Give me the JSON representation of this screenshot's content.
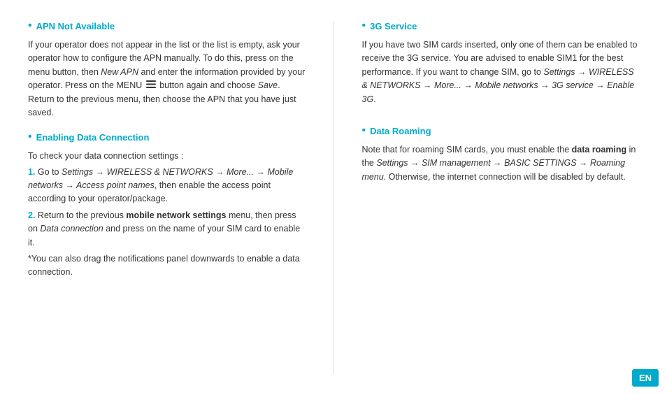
{
  "left": {
    "apn": {
      "title": "APN Not Available",
      "body": "If your operator does not appear in the list or the list is empty, ask your operator how to configure the APN manually. To do this, press on the menu button, then ",
      "new_apn": "New APN",
      "body2": " and enter the information provided by your operator. Press on the MENU ",
      "body3": " button again and choose ",
      "save": "Save",
      "body4": ". Return to the previous menu, then choose the APN that you have just saved."
    },
    "enabling": {
      "title": "Enabling Data Connection",
      "intro": "To check your data connection settings :",
      "step1_num": "1.",
      "step1_pre": "Go to ",
      "step1_italic": "Settings → WIRELESS & NETWORKS → More... → Mobile networks → Access point names",
      "step1_post": ", then enable the access point according to your operator/package.",
      "step2_num": "2.",
      "step2_pre": "Return to the previous ",
      "step2_bold": "mobile network settings",
      "step2_post": " menu, then press on ",
      "step2_italic": "Data connection",
      "step2_post2": " and press on the name of your SIM card to enable it.",
      "note": "*You can also drag the notifications panel downwards to enable a data connection."
    }
  },
  "right": {
    "service3g": {
      "title": "3G Service",
      "body": "If you have two SIM cards inserted, only one of them can be enabled to receive the 3G service. You are advised to enable SIM1 for the best performance. If you want to change SIM, go to ",
      "italic": "Settings → WIRELESS & NETWORKS → More... → Mobile networks → 3G service → Enable 3G",
      "body2": "."
    },
    "roaming": {
      "title": "Data Roaming",
      "body1": "Note that for roaming SIM cards, you must enable the ",
      "bold": "data roaming",
      "body2": " in the ",
      "italic": "Settings → SIM management → BASIC SETTINGS → Roaming menu",
      "body3": ". Otherwise, the internet connection will be disabled by default."
    }
  },
  "badge": "EN"
}
